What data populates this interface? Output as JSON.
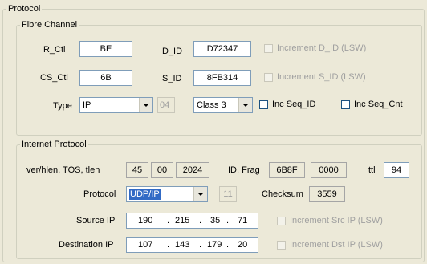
{
  "protocol_title": "Protocol",
  "fibre": {
    "title": "Fibre Channel",
    "r_ctl_label": "R_Ctl",
    "r_ctl_value": "BE",
    "d_id_label": "D_ID",
    "d_id_value": "D72347",
    "increment_d_id_label": "Increment D_ID (LSW)",
    "cs_ctl_label": "CS_Ctl",
    "cs_ctl_value": "6B",
    "s_id_label": "S_ID",
    "s_id_value": "8FB314",
    "increment_s_id_label": "Increment S_ID (LSW)",
    "type_label": "Type",
    "type_selected": "IP",
    "type_code": "04",
    "class_selected": "Class 3",
    "inc_seq_id_label": "Inc Seq_ID",
    "inc_seq_cnt_label": "Inc Seq_Cnt"
  },
  "ip": {
    "title": "Internet Protocol",
    "ver_label": "ver/hlen, TOS, tlen",
    "ver_value": "45",
    "tos_value": "00",
    "tlen_value": "2024",
    "id_frag_label": "ID, Frag",
    "id_value": "6B8F",
    "frag_value": "0000",
    "ttl_label": "ttl",
    "ttl_value": "94",
    "protocol_label": "Protocol",
    "protocol_selected": "UDP/IP",
    "protocol_code": "11",
    "checksum_label": "Checksum",
    "checksum_value": "3559",
    "source_label": "Source IP",
    "source_octets": [
      "190",
      "215",
      "35",
      "71"
    ],
    "increment_src_label": "Increment Src IP (LSW)",
    "dest_label": "Destination IP",
    "dest_octets": [
      "107",
      "143",
      "179",
      "20"
    ],
    "increment_dst_label": "Increment Dst IP (LSW)"
  }
}
